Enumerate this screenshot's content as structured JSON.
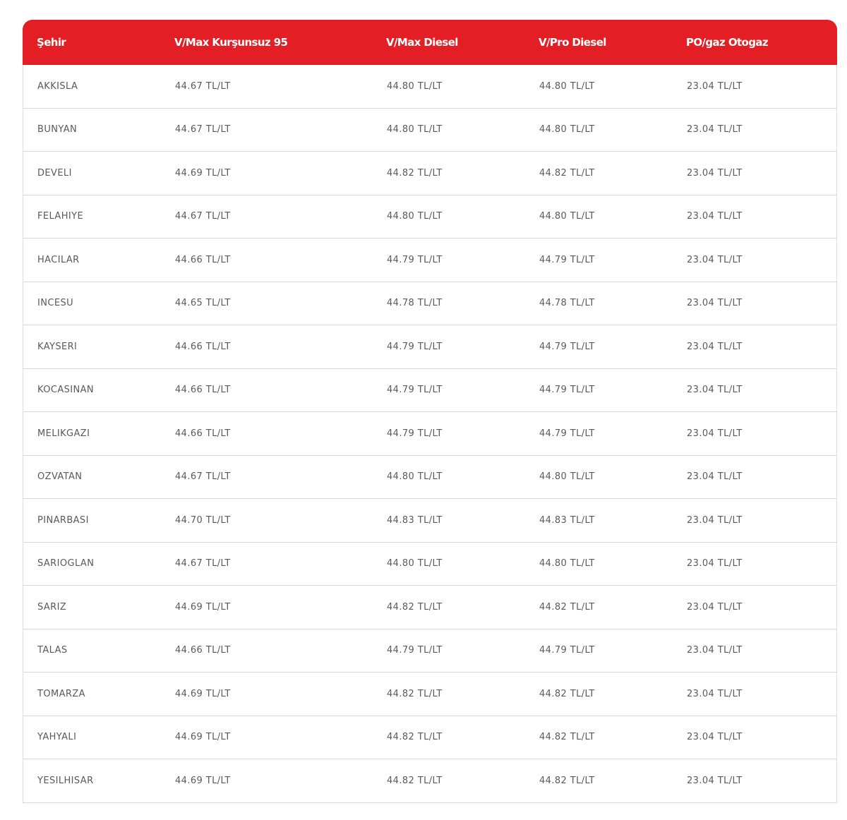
{
  "table": {
    "headers": [
      "Şehir",
      "V/Max Kurşunsuz 95",
      "V/Max Diesel",
      "V/Pro Diesel",
      "PO/gaz Otogaz"
    ],
    "rows": [
      [
        "AKKISLA",
        "44.67 TL/LT",
        "44.80 TL/LT",
        "44.80 TL/LT",
        "23.04 TL/LT"
      ],
      [
        "BUNYAN",
        "44.67 TL/LT",
        "44.80 TL/LT",
        "44.80 TL/LT",
        "23.04 TL/LT"
      ],
      [
        "DEVELI",
        "44.69 TL/LT",
        "44.82 TL/LT",
        "44.82 TL/LT",
        "23.04 TL/LT"
      ],
      [
        "FELAHIYE",
        "44.67 TL/LT",
        "44.80 TL/LT",
        "44.80 TL/LT",
        "23.04 TL/LT"
      ],
      [
        "HACILAR",
        "44.66 TL/LT",
        "44.79 TL/LT",
        "44.79 TL/LT",
        "23.04 TL/LT"
      ],
      [
        "INCESU",
        "44.65 TL/LT",
        "44.78 TL/LT",
        "44.78 TL/LT",
        "23.04 TL/LT"
      ],
      [
        "KAYSERI",
        "44.66 TL/LT",
        "44.79 TL/LT",
        "44.79 TL/LT",
        "23.04 TL/LT"
      ],
      [
        "KOCASINAN",
        "44.66 TL/LT",
        "44.79 TL/LT",
        "44.79 TL/LT",
        "23.04 TL/LT"
      ],
      [
        "MELIKGAZI",
        "44.66 TL/LT",
        "44.79 TL/LT",
        "44.79 TL/LT",
        "23.04 TL/LT"
      ],
      [
        "OZVATAN",
        "44.67 TL/LT",
        "44.80 TL/LT",
        "44.80 TL/LT",
        "23.04 TL/LT"
      ],
      [
        "PINARBASI",
        "44.70 TL/LT",
        "44.83 TL/LT",
        "44.83 TL/LT",
        "23.04 TL/LT"
      ],
      [
        "SARIOGLAN",
        "44.67 TL/LT",
        "44.80 TL/LT",
        "44.80 TL/LT",
        "23.04 TL/LT"
      ],
      [
        "SARIZ",
        "44.69 TL/LT",
        "44.82 TL/LT",
        "44.82 TL/LT",
        "23.04 TL/LT"
      ],
      [
        "TALAS",
        "44.66 TL/LT",
        "44.79 TL/LT",
        "44.79 TL/LT",
        "23.04 TL/LT"
      ],
      [
        "TOMARZA",
        "44.69 TL/LT",
        "44.82 TL/LT",
        "44.82 TL/LT",
        "23.04 TL/LT"
      ],
      [
        "YAHYALI",
        "44.69 TL/LT",
        "44.82 TL/LT",
        "44.82 TL/LT",
        "23.04 TL/LT"
      ],
      [
        "YESILHISAR",
        "44.69 TL/LT",
        "44.82 TL/LT",
        "44.82 TL/LT",
        "23.04 TL/LT"
      ]
    ]
  },
  "colors": {
    "header_bg": "#e31e24",
    "header_text": "#ffffff",
    "cell_text": "#5a5a5a",
    "row_border": "#d6d6d6"
  }
}
